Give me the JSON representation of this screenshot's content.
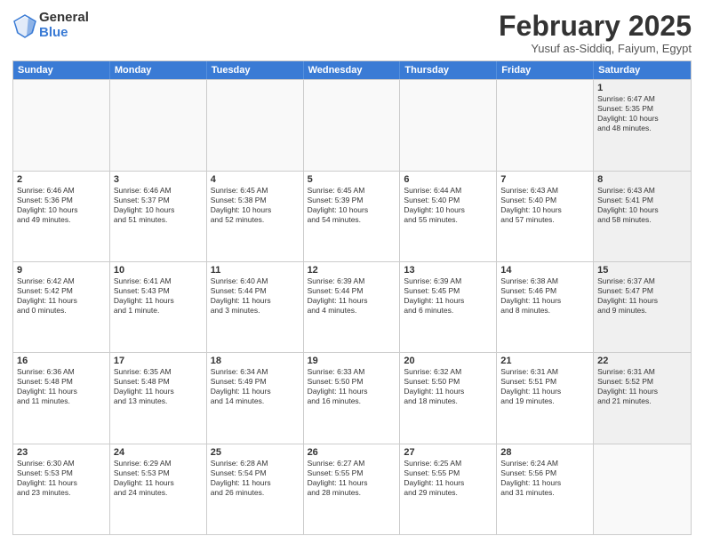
{
  "logo": {
    "general": "General",
    "blue": "Blue"
  },
  "header": {
    "month": "February 2025",
    "location": "Yusuf as-Siddiq, Faiyum, Egypt"
  },
  "weekdays": [
    "Sunday",
    "Monday",
    "Tuesday",
    "Wednesday",
    "Thursday",
    "Friday",
    "Saturday"
  ],
  "rows": [
    [
      {
        "day": "",
        "detail": "",
        "empty": true
      },
      {
        "day": "",
        "detail": "",
        "empty": true
      },
      {
        "day": "",
        "detail": "",
        "empty": true
      },
      {
        "day": "",
        "detail": "",
        "empty": true
      },
      {
        "day": "",
        "detail": "",
        "empty": true
      },
      {
        "day": "",
        "detail": "",
        "empty": true
      },
      {
        "day": "1",
        "detail": "Sunrise: 6:47 AM\nSunset: 5:35 PM\nDaylight: 10 hours\nand 48 minutes.",
        "empty": false,
        "shaded": true
      }
    ],
    [
      {
        "day": "2",
        "detail": "Sunrise: 6:46 AM\nSunset: 5:36 PM\nDaylight: 10 hours\nand 49 minutes.",
        "empty": false
      },
      {
        "day": "3",
        "detail": "Sunrise: 6:46 AM\nSunset: 5:37 PM\nDaylight: 10 hours\nand 51 minutes.",
        "empty": false
      },
      {
        "day": "4",
        "detail": "Sunrise: 6:45 AM\nSunset: 5:38 PM\nDaylight: 10 hours\nand 52 minutes.",
        "empty": false
      },
      {
        "day": "5",
        "detail": "Sunrise: 6:45 AM\nSunset: 5:39 PM\nDaylight: 10 hours\nand 54 minutes.",
        "empty": false
      },
      {
        "day": "6",
        "detail": "Sunrise: 6:44 AM\nSunset: 5:40 PM\nDaylight: 10 hours\nand 55 minutes.",
        "empty": false
      },
      {
        "day": "7",
        "detail": "Sunrise: 6:43 AM\nSunset: 5:40 PM\nDaylight: 10 hours\nand 57 minutes.",
        "empty": false
      },
      {
        "day": "8",
        "detail": "Sunrise: 6:43 AM\nSunset: 5:41 PM\nDaylight: 10 hours\nand 58 minutes.",
        "empty": false,
        "shaded": true
      }
    ],
    [
      {
        "day": "9",
        "detail": "Sunrise: 6:42 AM\nSunset: 5:42 PM\nDaylight: 11 hours\nand 0 minutes.",
        "empty": false
      },
      {
        "day": "10",
        "detail": "Sunrise: 6:41 AM\nSunset: 5:43 PM\nDaylight: 11 hours\nand 1 minute.",
        "empty": false
      },
      {
        "day": "11",
        "detail": "Sunrise: 6:40 AM\nSunset: 5:44 PM\nDaylight: 11 hours\nand 3 minutes.",
        "empty": false
      },
      {
        "day": "12",
        "detail": "Sunrise: 6:39 AM\nSunset: 5:44 PM\nDaylight: 11 hours\nand 4 minutes.",
        "empty": false
      },
      {
        "day": "13",
        "detail": "Sunrise: 6:39 AM\nSunset: 5:45 PM\nDaylight: 11 hours\nand 6 minutes.",
        "empty": false
      },
      {
        "day": "14",
        "detail": "Sunrise: 6:38 AM\nSunset: 5:46 PM\nDaylight: 11 hours\nand 8 minutes.",
        "empty": false
      },
      {
        "day": "15",
        "detail": "Sunrise: 6:37 AM\nSunset: 5:47 PM\nDaylight: 11 hours\nand 9 minutes.",
        "empty": false,
        "shaded": true
      }
    ],
    [
      {
        "day": "16",
        "detail": "Sunrise: 6:36 AM\nSunset: 5:48 PM\nDaylight: 11 hours\nand 11 minutes.",
        "empty": false
      },
      {
        "day": "17",
        "detail": "Sunrise: 6:35 AM\nSunset: 5:48 PM\nDaylight: 11 hours\nand 13 minutes.",
        "empty": false
      },
      {
        "day": "18",
        "detail": "Sunrise: 6:34 AM\nSunset: 5:49 PM\nDaylight: 11 hours\nand 14 minutes.",
        "empty": false
      },
      {
        "day": "19",
        "detail": "Sunrise: 6:33 AM\nSunset: 5:50 PM\nDaylight: 11 hours\nand 16 minutes.",
        "empty": false
      },
      {
        "day": "20",
        "detail": "Sunrise: 6:32 AM\nSunset: 5:50 PM\nDaylight: 11 hours\nand 18 minutes.",
        "empty": false
      },
      {
        "day": "21",
        "detail": "Sunrise: 6:31 AM\nSunset: 5:51 PM\nDaylight: 11 hours\nand 19 minutes.",
        "empty": false
      },
      {
        "day": "22",
        "detail": "Sunrise: 6:31 AM\nSunset: 5:52 PM\nDaylight: 11 hours\nand 21 minutes.",
        "empty": false,
        "shaded": true
      }
    ],
    [
      {
        "day": "23",
        "detail": "Sunrise: 6:30 AM\nSunset: 5:53 PM\nDaylight: 11 hours\nand 23 minutes.",
        "empty": false
      },
      {
        "day": "24",
        "detail": "Sunrise: 6:29 AM\nSunset: 5:53 PM\nDaylight: 11 hours\nand 24 minutes.",
        "empty": false
      },
      {
        "day": "25",
        "detail": "Sunrise: 6:28 AM\nSunset: 5:54 PM\nDaylight: 11 hours\nand 26 minutes.",
        "empty": false
      },
      {
        "day": "26",
        "detail": "Sunrise: 6:27 AM\nSunset: 5:55 PM\nDaylight: 11 hours\nand 28 minutes.",
        "empty": false
      },
      {
        "day": "27",
        "detail": "Sunrise: 6:25 AM\nSunset: 5:55 PM\nDaylight: 11 hours\nand 29 minutes.",
        "empty": false
      },
      {
        "day": "28",
        "detail": "Sunrise: 6:24 AM\nSunset: 5:56 PM\nDaylight: 11 hours\nand 31 minutes.",
        "empty": false
      },
      {
        "day": "",
        "detail": "",
        "empty": true,
        "shaded": true
      }
    ]
  ]
}
